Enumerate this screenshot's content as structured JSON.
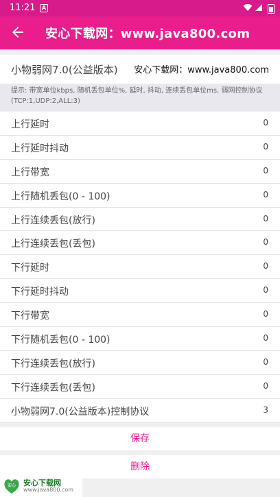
{
  "status_bar": {
    "time": "11:21",
    "notif_letter": "A"
  },
  "app_bar": {
    "title": "安心下载网：www.java800.com"
  },
  "header": {
    "title": "小物弱网7.0(公益版本)",
    "site": "安心下载网：www.java800.com"
  },
  "hint": "提示: 带宽单位kbps, 随机丢包单位%, 延时, 抖动, 连续丢包单位ms, 弱网控制协议(TCP:1,UDP:2,ALL:3)",
  "rows": [
    {
      "label": "上行延时",
      "value": "0"
    },
    {
      "label": "上行延时抖动",
      "value": "0"
    },
    {
      "label": "上行带宽",
      "value": "0"
    },
    {
      "label": "上行随机丢包(0 - 100)",
      "value": "0"
    },
    {
      "label": "上行连续丢包(放行)",
      "value": "0"
    },
    {
      "label": "上行连续丢包(丢包)",
      "value": "0"
    },
    {
      "label": "下行延时",
      "value": "0"
    },
    {
      "label": "下行延时抖动",
      "value": "0"
    },
    {
      "label": "下行带宽",
      "value": "0"
    },
    {
      "label": "下行随机丢包(0 - 100)",
      "value": "0"
    },
    {
      "label": "下行连续丢包(放行)",
      "value": "0"
    },
    {
      "label": "下行连续丢包(丢包)",
      "value": "0"
    },
    {
      "label": "小物弱网7.0(公益版本)控制协议",
      "value": "3"
    }
  ],
  "buttons": {
    "save": "保存",
    "delete": "删除"
  },
  "watermark": {
    "title": "安心下载网",
    "url": "www.java800.com",
    "logo_text": "安心"
  },
  "colors": {
    "accent": "#e91e8c",
    "status_bar": "#d81b8a"
  },
  "icons": {
    "back": "arrow-left-icon",
    "wifi": "wifi-icon",
    "signal": "signal-icon",
    "battery": "battery-icon"
  }
}
